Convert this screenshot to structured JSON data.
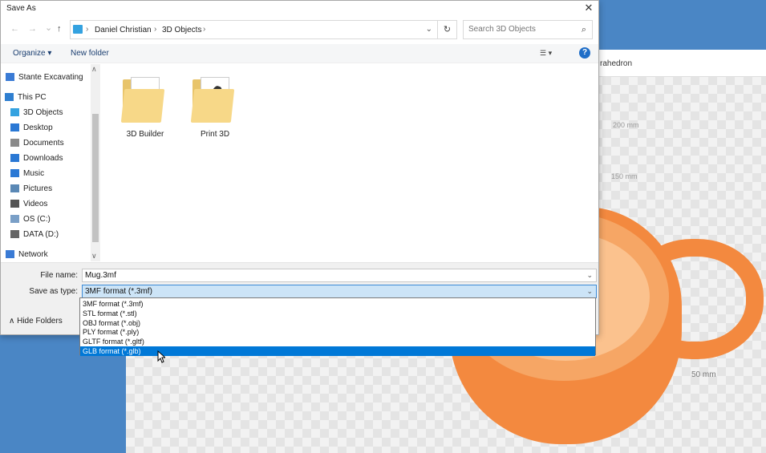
{
  "background_app": {
    "tab_label": "rahedron",
    "ruler_labels": [
      "200 mm",
      "150 mm",
      "50 mm"
    ]
  },
  "dialog": {
    "title": "Save As",
    "close_glyph": "✕",
    "nav_glyphs": {
      "back": "←",
      "forward": "→",
      "recent": "⌄",
      "up": "↑"
    },
    "breadcrumb": [
      "Daniel Christian",
      "3D Objects"
    ],
    "breadcrumb_sep": "›",
    "dropdown_glyph": "⌄",
    "refresh_glyph": "↻",
    "search_placeholder": "Search 3D Objects",
    "search_glyph": "⌕",
    "toolbar": {
      "organize": "Organize ▾",
      "new_folder": "New folder",
      "view": "☰ ▾",
      "help": "?"
    },
    "nav_pane": [
      {
        "label": "Stante Excavating",
        "icon": "building-icon",
        "color": "#3a7bd5"
      },
      {
        "label": "This PC",
        "icon": "computer-icon",
        "color": "#2f7fd0"
      },
      {
        "label": "3D Objects",
        "icon": "cube-icon",
        "color": "#34a2e0"
      },
      {
        "label": "Desktop",
        "icon": "desktop-icon",
        "color": "#2a78d4"
      },
      {
        "label": "Documents",
        "icon": "document-icon",
        "color": "#8a8a8a"
      },
      {
        "label": "Downloads",
        "icon": "download-icon",
        "color": "#2a78d4"
      },
      {
        "label": "Music",
        "icon": "music-icon",
        "color": "#2a78d4"
      },
      {
        "label": "Pictures",
        "icon": "pictures-icon",
        "color": "#5a88b5"
      },
      {
        "label": "Videos",
        "icon": "video-icon",
        "color": "#555555"
      },
      {
        "label": "OS (C:)",
        "icon": "drive-icon",
        "color": "#7a9fc7"
      },
      {
        "label": "DATA (D:)",
        "icon": "drive-icon",
        "color": "#666666"
      },
      {
        "label": "Network",
        "icon": "network-icon",
        "color": "#3a7bd5"
      }
    ],
    "folders": [
      {
        "label": "3D Builder"
      },
      {
        "label": "Print 3D"
      }
    ],
    "file_name_label": "File name:",
    "file_name_value": "Mug.3mf",
    "save_type_label": "Save as type:",
    "save_type_value": "3MF format (*.3mf)",
    "hide_folders": "∧  Hide Folders",
    "type_options": [
      "3MF format (*.3mf)",
      "STL format (*.stl)",
      "OBJ format (*.obj)",
      "PLY format (*.ply)",
      "GLTF format (*.gltf)",
      "GLB format (*.glb)"
    ],
    "selected_type_index": 5
  },
  "colors": {
    "selection": "#0078d7",
    "mug": "#f3893f",
    "desktop": "#4a86c5"
  }
}
